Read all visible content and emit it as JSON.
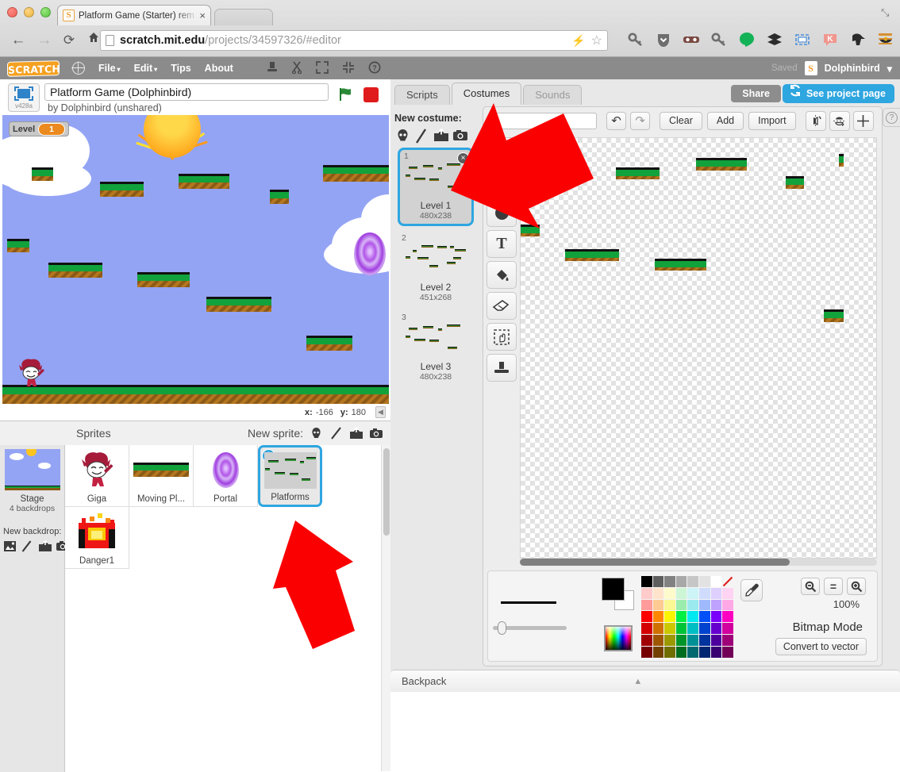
{
  "browser": {
    "tab_title": "Platform Game (Starter) rem",
    "tab_close": "×",
    "back_icon": "←",
    "forward_icon": "→",
    "reload_icon": "⟳",
    "home_icon": "⌂",
    "url_prefix": "scratch.mit.edu",
    "url_suffix": "/projects/34597326/#editor",
    "bolt_icon": "⚡",
    "star_icon": "☆",
    "expand_icon": "⤡",
    "extensions": [
      {
        "name": "key-icon"
      },
      {
        "name": "shield-icon"
      },
      {
        "name": "mask-icon"
      },
      {
        "name": "key2-icon"
      },
      {
        "name": "hangouts-icon"
      },
      {
        "name": "layers-icon"
      },
      {
        "name": "screenshot-icon"
      },
      {
        "name": "k-badge-icon"
      },
      {
        "name": "ninja-icon"
      },
      {
        "name": "owl-icon"
      }
    ]
  },
  "scratch_menu": {
    "logo": "SCRATCH",
    "globe_icon": "globe-icon",
    "items": [
      {
        "label": "File",
        "caret": "▾"
      },
      {
        "label": "Edit",
        "caret": "▾"
      },
      {
        "label": "Tips",
        "caret": ""
      },
      {
        "label": "About",
        "caret": ""
      }
    ],
    "tools": [
      {
        "name": "stamp-icon",
        "glyph": "⬇"
      },
      {
        "name": "scissors-icon",
        "glyph": "✂"
      },
      {
        "name": "grow-icon",
        "glyph": "⤢"
      },
      {
        "name": "shrink-icon",
        "glyph": "⤣"
      },
      {
        "name": "help-icon",
        "glyph": "?"
      }
    ],
    "saved_text": "Saved",
    "user_initial": "S",
    "username": "Dolphinbird",
    "user_caret": "▾"
  },
  "project": {
    "version_tag": "v428a",
    "title": "Platform Game (Dolphinbird)",
    "title_placeholder": "Project title",
    "byline": "by Dolphinbird (unshared)",
    "green_flag": "green-flag-icon",
    "stop_button": "stop-icon"
  },
  "stage": {
    "level_label": "Level",
    "level_value": "1",
    "mouse_x_key": "x:",
    "mouse_x_value": "-166",
    "mouse_y_key": "y:",
    "mouse_y_value": "180",
    "collapse_icon": "◀",
    "sky_color": "#94a4f4",
    "platform_green": "#11a23c",
    "platform_brown": "#a06a1c"
  },
  "sprite_pane": {
    "sprites_label": "Sprites",
    "new_sprite_label": "New sprite:",
    "new_sprite_icons": [
      "paint-new-sprite-icon",
      "paint-brush-icon",
      "upload-sprite-icon",
      "camera-sprite-icon"
    ],
    "stage_name": "Stage",
    "stage_backdrops": "4 backdrops",
    "new_backdrop_label": "New backdrop:",
    "new_backdrop_icons": [
      "backdrop-library-icon",
      "paint-backdrop-icon",
      "upload-backdrop-icon",
      "camera-backdrop-icon"
    ],
    "sprites": [
      {
        "name": "Giga",
        "thumb": "giga",
        "selected": false,
        "info": false
      },
      {
        "name": "Moving Pl...",
        "thumb": "movingplatform",
        "selected": false,
        "info": false
      },
      {
        "name": "Portal",
        "thumb": "portal",
        "selected": false,
        "info": false
      },
      {
        "name": "Platforms",
        "thumb": "platforms",
        "selected": true,
        "info": true,
        "info_glyph": "i"
      },
      {
        "name": "Danger1",
        "thumb": "danger",
        "selected": false,
        "info": false
      }
    ]
  },
  "right_panel": {
    "tabs": [
      {
        "label": "Scripts",
        "state": "inactive"
      },
      {
        "label": "Costumes",
        "state": "active"
      },
      {
        "label": "Sounds",
        "state": "dim"
      }
    ],
    "share_button": "Share",
    "see_project_page_button": "See project page",
    "see_project_icon": "refresh-arrows-icon",
    "help_icon": "?"
  },
  "costume_panel": {
    "new_costume_label": "New costume:",
    "new_costume_icons": [
      "costume-library-icon",
      "paint-costume-icon",
      "upload-costume-icon",
      "camera-costume-icon"
    ],
    "delete_glyph": "×",
    "costumes": [
      {
        "index": "1",
        "name": "Level 1",
        "size": "480x238",
        "selected": true
      },
      {
        "index": "2",
        "name": "Level 2",
        "size": "451x268",
        "selected": false
      },
      {
        "index": "3",
        "name": "Level 3",
        "size": "480x238",
        "selected": false
      }
    ]
  },
  "paint_editor": {
    "costume_name_value": "L",
    "costume_name_placeholder": "Costume name",
    "undo_icon": "↶",
    "redo_icon": "↷",
    "clear_button": "Clear",
    "add_button": "Add",
    "import_button": "Import",
    "flip_horizontal_icon": "flip-horizontal-icon",
    "flip_vertical_icon": "flip-vertical-icon",
    "set_center_icon": "set-costume-center-icon",
    "tools": [
      {
        "name": "line-tool",
        "glyph": "╱"
      },
      {
        "name": "rectangle-tool",
        "glyph": "▬"
      },
      {
        "name": "ellipse-tool",
        "glyph": "⬤"
      },
      {
        "name": "text-tool",
        "glyph": "T"
      },
      {
        "name": "fill-tool",
        "glyph": "fill-bucket-icon"
      },
      {
        "name": "eraser-tool",
        "glyph": "eraser-icon"
      },
      {
        "name": "select-tool",
        "glyph": "select-icon"
      },
      {
        "name": "stamp-tool",
        "glyph": "stamp-icon"
      }
    ],
    "zoom_out_icon": "⊖",
    "zoom_reset_icon": "=",
    "zoom_in_icon": "⊕",
    "zoom_percent": "100%",
    "mode_label": "Bitmap Mode",
    "convert_button": "Convert to vector",
    "eyedropper_icon": "eyedropper-icon",
    "foreground_color": "#000000",
    "background_color": "#ffffff",
    "palette_colors": [
      "#000000",
      "#5e5e5e",
      "#818181",
      "#a8a8a8",
      "#c6c6c6",
      "#e2e2e2",
      "#ffffff",
      "__NONE__",
      "#ffcbcb",
      "#ffe4cb",
      "#fdfbcb",
      "#cdf6d6",
      "#cdf4f7",
      "#cfdcfd",
      "#ded0fe",
      "#ffd3f2",
      "#ff9b9b",
      "#ffcb93",
      "#fbf793",
      "#9bedae",
      "#9beaf0",
      "#9fbafc",
      "#bea2fd",
      "#ffa8e6",
      "#fe0000",
      "#ff8700",
      "#fbf600",
      "#00ef43",
      "#00e8f0",
      "#0050f7",
      "#7a00fb",
      "#ff00c0",
      "#d40000",
      "#cf7000",
      "#cbc800",
      "#00c438",
      "#00bec4",
      "#0043ce",
      "#6500cf",
      "#d1009e",
      "#a10000",
      "#9e5600",
      "#9b9800",
      "#009529",
      "#009197",
      "#00339d",
      "#4d009e",
      "#9e0078",
      "#760000",
      "#734000",
      "#706e00",
      "#006c1e",
      "#00696f",
      "#002572",
      "#380073",
      "#730057"
    ]
  },
  "backpack": {
    "label": "Backpack",
    "caret": "▲"
  },
  "annotations": [
    {
      "name": "red-arrow-paint-toolbar",
      "color": "#fb0000"
    },
    {
      "name": "red-arrow-sprite-list",
      "color": "#fb0000"
    }
  ]
}
